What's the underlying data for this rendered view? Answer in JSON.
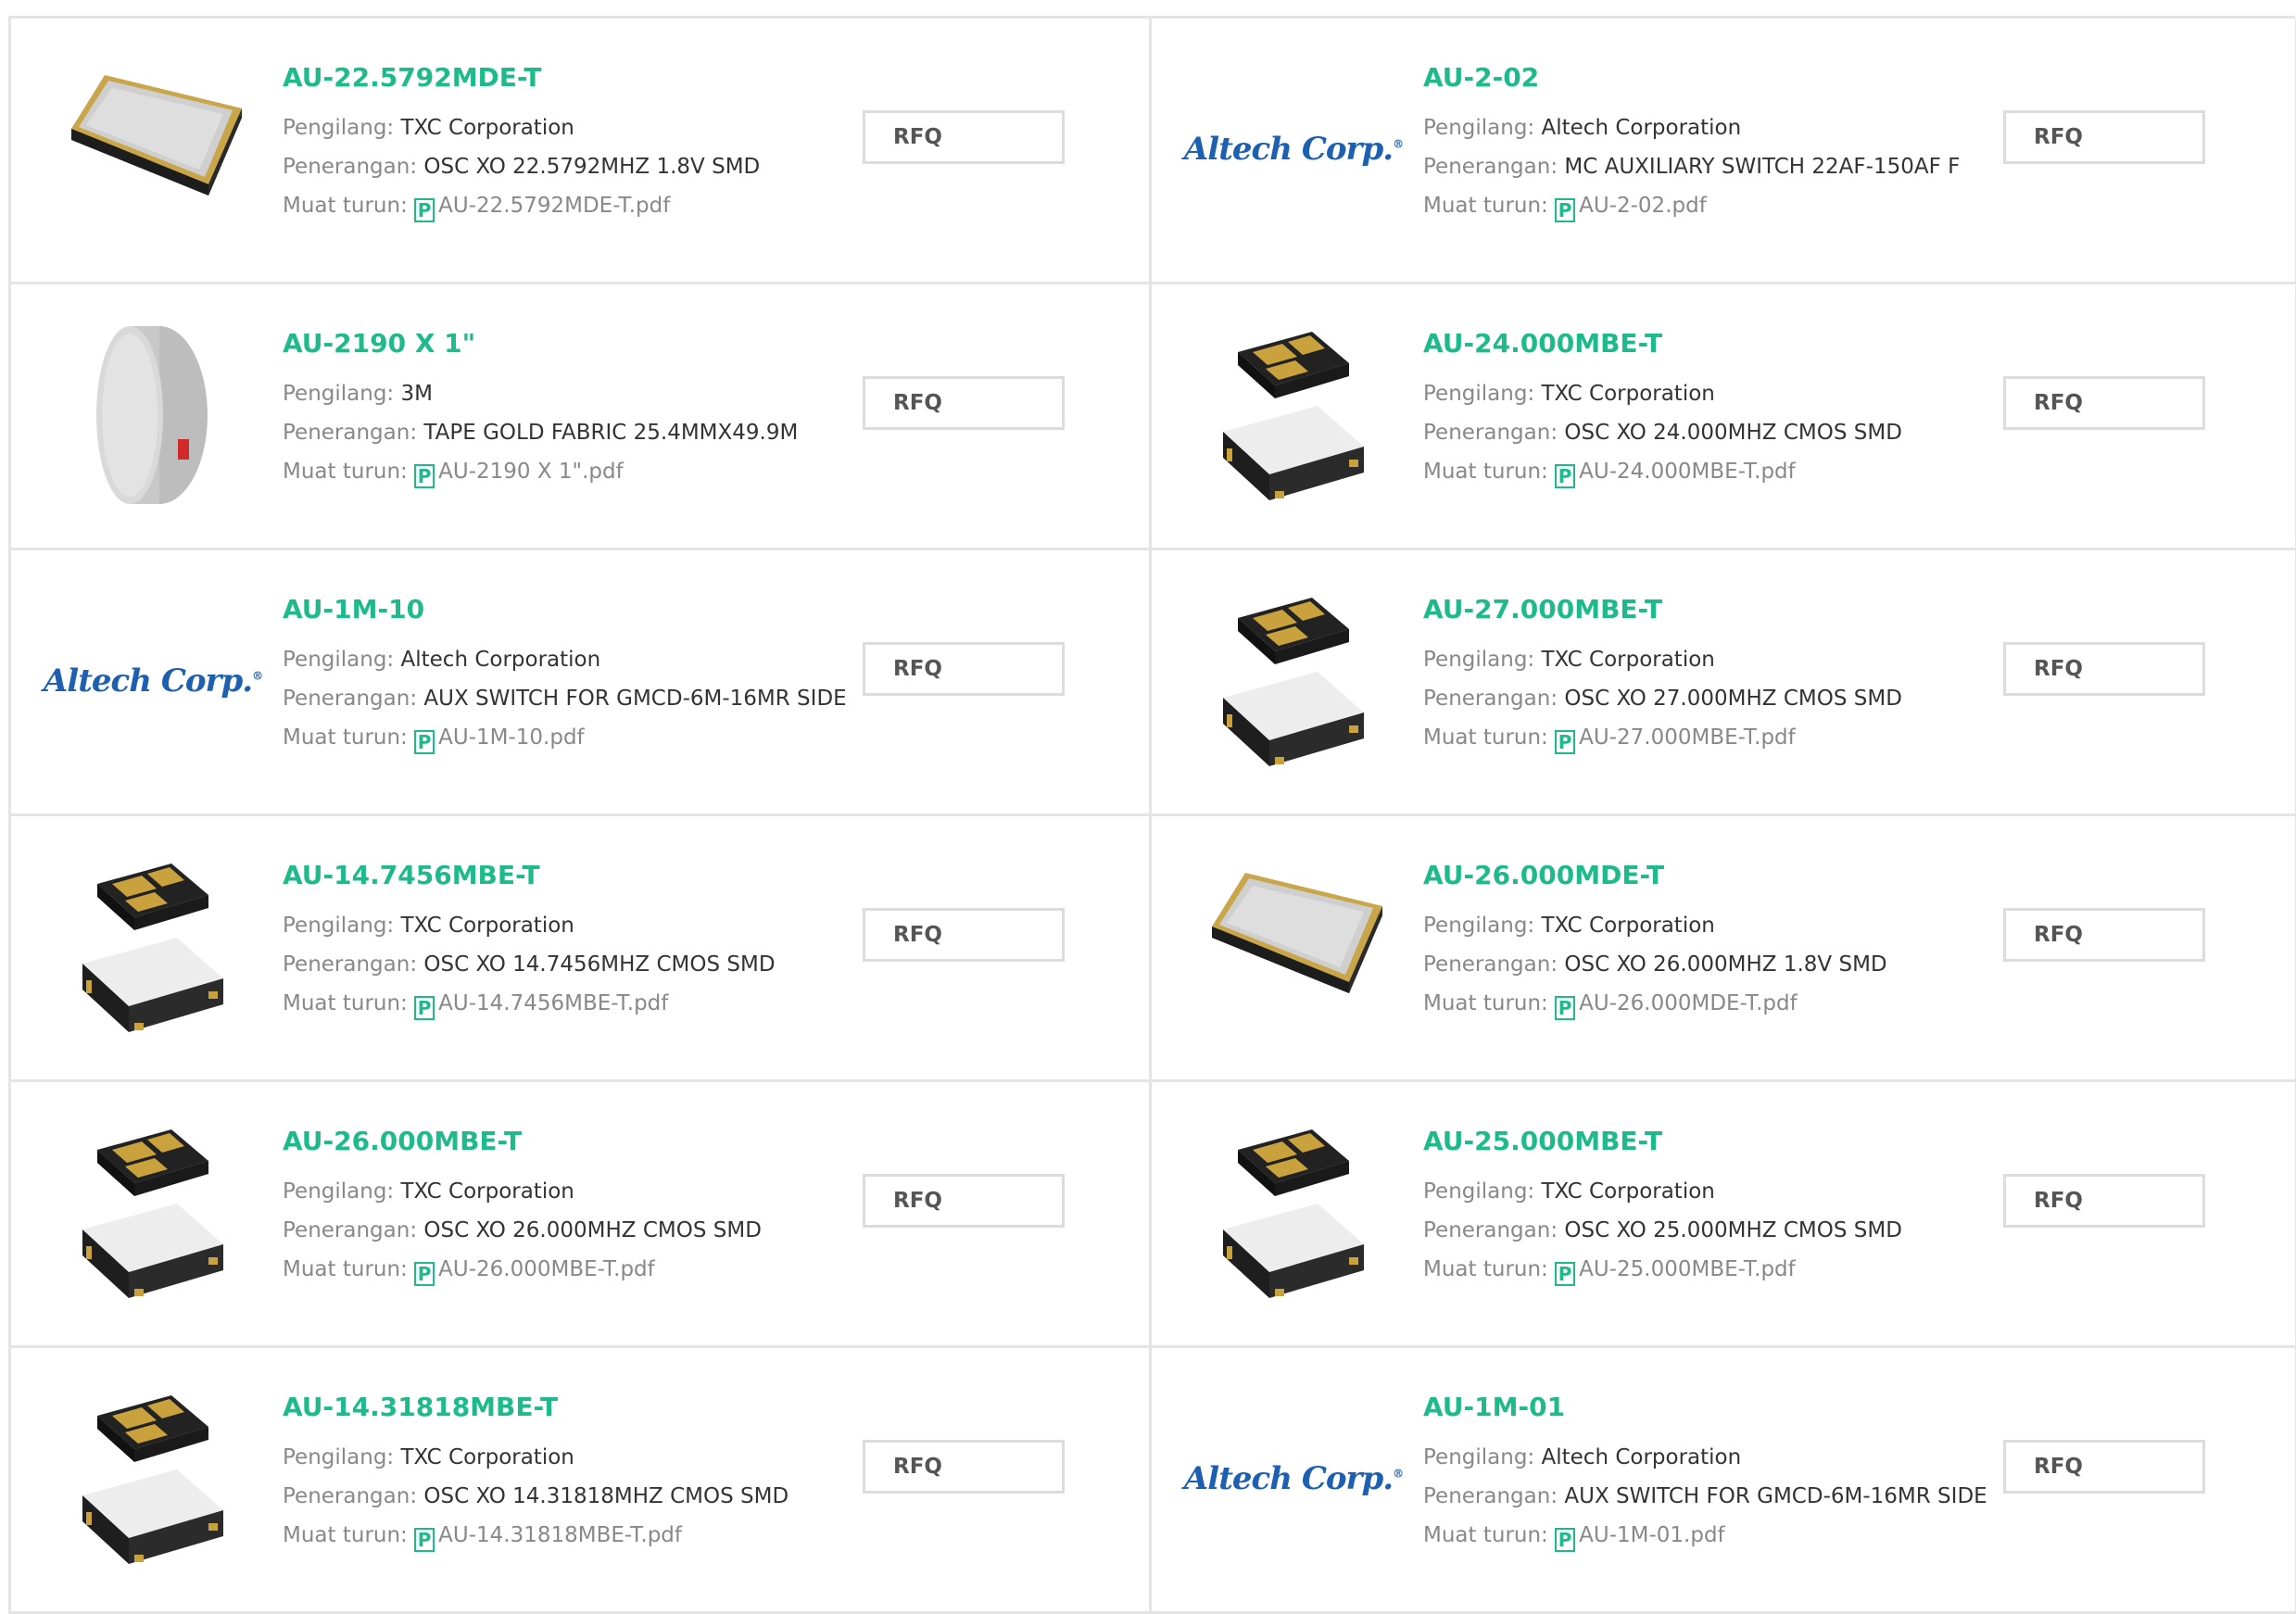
{
  "labels": {
    "manufacturer": "Pengilang:",
    "description": "Penerangan:",
    "download": "Muat turun:",
    "rfq": "RFQ",
    "pdf_glyph": "P"
  },
  "colors": {
    "accent": "#1fba8c",
    "border": "#e4e4e4",
    "altech_blue": "#1d5fb0"
  },
  "products": [
    {
      "part": "AU-22.5792MDE-T",
      "manufacturer": "TXC Corporation",
      "description": "OSC XO 22.5792MHZ 1.8V SMD",
      "file": "AU-22.5792MDE-T.pdf",
      "image": "metal-can-oscillator"
    },
    {
      "part": "AU-2-02",
      "manufacturer": "Altech Corporation",
      "description": "MC AUXILIARY SWITCH 22AF-150AF F",
      "file": "AU-2-02.pdf",
      "image": "altech-logo",
      "logo_text": "Altech Corp.",
      "logo_mark": "®"
    },
    {
      "part": "AU-2190 X 1\"",
      "manufacturer": "3M",
      "description": "TAPE GOLD FABRIC 25.4MMX49.9M",
      "file": "AU-2190 X 1\".pdf",
      "image": "tape-roll"
    },
    {
      "part": "AU-24.000MBE-T",
      "manufacturer": "TXC Corporation",
      "description": "OSC XO 24.000MHZ CMOS SMD",
      "file": "AU-24.000MBE-T.pdf",
      "image": "smd-oscillator"
    },
    {
      "part": "AU-1M-10",
      "manufacturer": "Altech Corporation",
      "description": "AUX SWITCH FOR GMCD-6M-16MR SIDE",
      "file": "AU-1M-10.pdf",
      "image": "altech-logo",
      "logo_text": "Altech Corp.",
      "logo_mark": "®"
    },
    {
      "part": "AU-27.000MBE-T",
      "manufacturer": "TXC Corporation",
      "description": "OSC XO 27.000MHZ CMOS SMD",
      "file": "AU-27.000MBE-T.pdf",
      "image": "smd-oscillator"
    },
    {
      "part": "AU-14.7456MBE-T",
      "manufacturer": "TXC Corporation",
      "description": "OSC XO 14.7456MHZ CMOS SMD",
      "file": "AU-14.7456MBE-T.pdf",
      "image": "smd-oscillator"
    },
    {
      "part": "AU-26.000MDE-T",
      "manufacturer": "TXC Corporation",
      "description": "OSC XO 26.000MHZ 1.8V SMD",
      "file": "AU-26.000MDE-T.pdf",
      "image": "metal-can-oscillator"
    },
    {
      "part": "AU-26.000MBE-T",
      "manufacturer": "TXC Corporation",
      "description": "OSC XO 26.000MHZ CMOS SMD",
      "file": "AU-26.000MBE-T.pdf",
      "image": "smd-oscillator"
    },
    {
      "part": "AU-25.000MBE-T",
      "manufacturer": "TXC Corporation",
      "description": "OSC XO 25.000MHZ CMOS SMD",
      "file": "AU-25.000MBE-T.pdf",
      "image": "smd-oscillator"
    },
    {
      "part": "AU-14.31818MBE-T",
      "manufacturer": "TXC Corporation",
      "description": "OSC XO 14.31818MHZ CMOS SMD",
      "file": "AU-14.31818MBE-T.pdf",
      "image": "smd-oscillator"
    },
    {
      "part": "AU-1M-01",
      "manufacturer": "Altech Corporation",
      "description": "AUX SWITCH FOR GMCD-6M-16MR SIDE",
      "file": "AU-1M-01.pdf",
      "image": "altech-logo",
      "logo_text": "Altech Corp.",
      "logo_mark": "®"
    }
  ]
}
